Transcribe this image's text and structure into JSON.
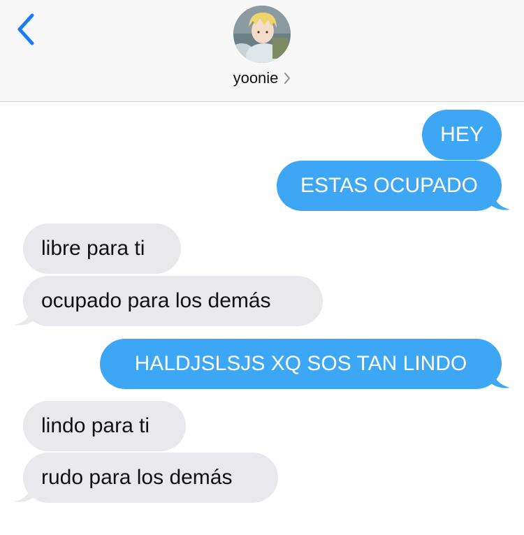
{
  "header": {
    "back_icon": "chevron-left-icon",
    "contact_name": "yoonie",
    "contact_chevron": "chevron-right-icon",
    "accent_color": "#3ea7f5"
  },
  "messages": [
    {
      "direction": "outgoing",
      "text": "HEY"
    },
    {
      "direction": "outgoing",
      "text": "ESTAS OCUPADO"
    },
    {
      "direction": "incoming",
      "text": "libre para ti"
    },
    {
      "direction": "incoming",
      "text": "ocupado para los demás"
    },
    {
      "direction": "outgoing",
      "text": "HALDJSLSJS XQ SOS TAN LINDO"
    },
    {
      "direction": "incoming",
      "text": "lindo para ti"
    },
    {
      "direction": "incoming",
      "text": "rudo para los demás"
    }
  ],
  "colors": {
    "outgoing_bubble": "#3ea7f5",
    "incoming_bubble": "#e8e8ed",
    "header_bg": "#f7f7f7"
  }
}
